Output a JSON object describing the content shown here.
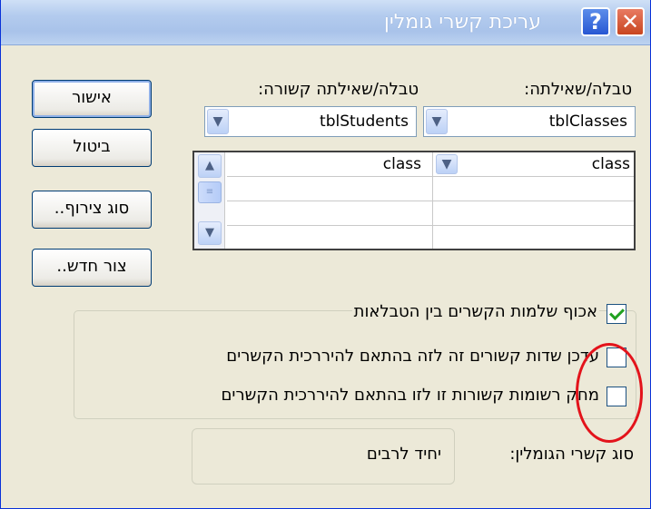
{
  "window": {
    "title": "עריכת קשרי גומלין"
  },
  "titlebar_buttons": {
    "help_glyph": "?",
    "close_glyph": "✕"
  },
  "left_table": {
    "label": "טבלה/שאילתה:",
    "value": "tblClasses"
  },
  "right_table": {
    "label": "טבלה/שאילתה קשורה:",
    "value": "tblStudents"
  },
  "fields_grid": {
    "rows": [
      {
        "left_field": "class",
        "right_field": "class"
      },
      {
        "left_field": "",
        "right_field": ""
      },
      {
        "left_field": "",
        "right_field": ""
      },
      {
        "left_field": "",
        "right_field": ""
      }
    ]
  },
  "buttons": {
    "ok": "אישור",
    "cancel": "ביטול",
    "join_type": "סוג צירוף..",
    "create_new": "צור חדש.."
  },
  "options": {
    "enforce_integrity": {
      "label": "אכוף שלמות הקשרים בין הטבלאות",
      "checked": true
    },
    "cascade_update": {
      "label": "עדכן שדות קשורים זה לזה בהתאם להיררכית הקשרים",
      "checked": false
    },
    "cascade_delete": {
      "label": "מחק רשומות קשורות זו לזו בהתאם להיררכית הקשרים",
      "checked": false
    }
  },
  "relationship_type": {
    "label": "סוג קשרי הגומלין:",
    "value": "יחיד לרבים"
  },
  "icons": {
    "dropdown_arrow": "chevron-down-icon",
    "scroll_up": "chevron-up-icon",
    "scroll_down": "chevron-down-icon",
    "help": "help-icon",
    "close": "close-icon"
  },
  "colors": {
    "annotation_circle": "#e3131b",
    "title_text": "#ffffff",
    "checkmark": "#21a121"
  }
}
